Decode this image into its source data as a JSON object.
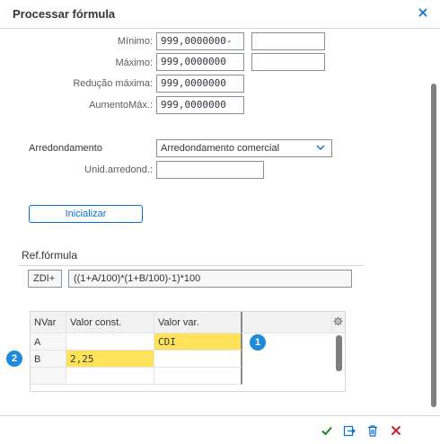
{
  "dialog": {
    "title": "Processar fórmula",
    "close_icon": "close-icon"
  },
  "limits": {
    "minimo_label": "Mínimo:",
    "minimo_value": "999,0000000-",
    "maximo_label": "Máximo:",
    "maximo_value": "999,0000000",
    "reducao_label": "Redução máxima:",
    "reducao_value": "999,0000000",
    "aumento_label": "AumentoMáx.:",
    "aumento_value": "999,0000000"
  },
  "rounding": {
    "label": "Arredondamento",
    "selected": "Arredondamento comercial",
    "unit_label": "Unid.arredond.:",
    "unit_value": ""
  },
  "init_button": "Inicializar",
  "formula": {
    "section_title": "Ref.fórmula",
    "code": "ZDI+",
    "expression": "((1+A/100)*(1+B/100)-1)*100"
  },
  "table": {
    "columns": [
      "NVar",
      "Valor const.",
      "Valor var."
    ],
    "rows": [
      {
        "nvar": "A",
        "const": "",
        "var": "CDI"
      },
      {
        "nvar": "B",
        "const": "2,25",
        "var": ""
      }
    ],
    "settings_icon": "gear-icon"
  },
  "badges": [
    "1",
    "2"
  ],
  "colors": {
    "accent": "#0a6ed1",
    "highlight": "#fde25a",
    "badge": "#1f8ad9"
  },
  "footer": {
    "confirm_icon": "checkmark-icon",
    "transfer_icon": "transfer-icon",
    "delete_icon": "trash-icon",
    "cancel_icon": "cancel-icon"
  }
}
